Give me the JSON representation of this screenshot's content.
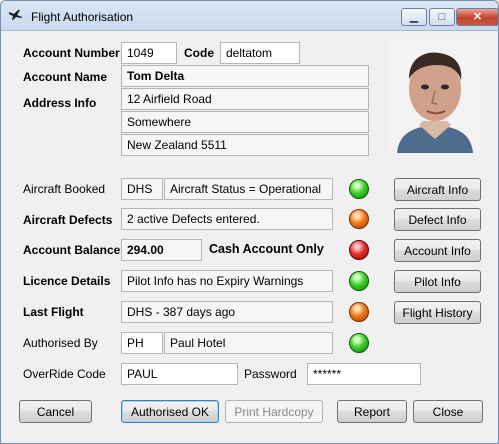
{
  "window": {
    "title": "Flight Authorisation",
    "minimize": "▁",
    "maximize": "□",
    "close": "✕"
  },
  "account": {
    "number_label": "Account Number",
    "number": "1049",
    "code_label": "Code",
    "code": "deltatom",
    "name_label": "Account Name",
    "name": "Tom Delta",
    "address_label": "Address Info",
    "address1": "12 Airfield Road",
    "address2": "Somewhere",
    "address3": "New Zealand 5511"
  },
  "rows": {
    "aircraft_booked_label": "Aircraft Booked",
    "aircraft_code": "DHS",
    "aircraft_status": "Aircraft Status = Operational",
    "aircraft_light": "green",
    "aircraft_button": "Aircraft Info",
    "defects_label": "Aircraft Defects",
    "defects_value": "2 active Defects entered.",
    "defects_light": "orange",
    "defects_button": "Defect Info",
    "balance_label": "Account Balance",
    "balance_value": "294.00",
    "balance_note": "Cash Account Only",
    "balance_light": "red",
    "balance_button": "Account Info",
    "licence_label": "Licence Details",
    "licence_value": "Pilot Info has no Expiry Warnings",
    "licence_light": "green",
    "licence_button": "Pilot Info",
    "lastflight_label": "Last Flight",
    "lastflight_value": "DHS - 387 days ago",
    "lastflight_light": "orange",
    "lastflight_button": "Flight History",
    "authorised_label": "Authorised By",
    "authorised_code": "PH",
    "authorised_name": "Paul Hotel",
    "authorised_light": "green",
    "override_label": "OverRide Code",
    "override_value": "PAUL",
    "password_label": "Password",
    "password_value": "******"
  },
  "buttons": {
    "cancel": "Cancel",
    "authorised_ok": "Authorised OK",
    "print_hardcopy": "Print Hardcopy",
    "report": "Report",
    "close": "Close"
  },
  "colors": {
    "green": "#3fcf2a",
    "orange": "#f07b1a",
    "red": "#e53030"
  }
}
